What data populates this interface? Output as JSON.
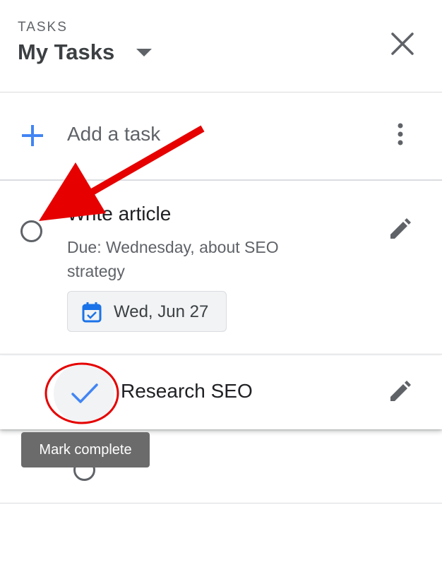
{
  "header": {
    "label": "TASKS",
    "list_name": "My Tasks"
  },
  "add_task": {
    "label": "Add a task"
  },
  "tasks": [
    {
      "title": "Write article",
      "notes": "Due: Wednesday, about SEO strategy",
      "due_date": "Wed, Jun 27",
      "completed": false
    },
    {
      "title": "Research SEO",
      "completed": false,
      "hovered": true
    }
  ],
  "tooltip": {
    "text": "Mark complete"
  },
  "colors": {
    "accent": "#4285f4",
    "icon": "#5f6368",
    "annotation": "#e60000"
  },
  "icons": [
    "close-icon",
    "plus-icon",
    "more-vert-icon",
    "calendar-icon",
    "edit-icon",
    "check-icon",
    "circle-icon",
    "chevron-down-icon"
  ]
}
